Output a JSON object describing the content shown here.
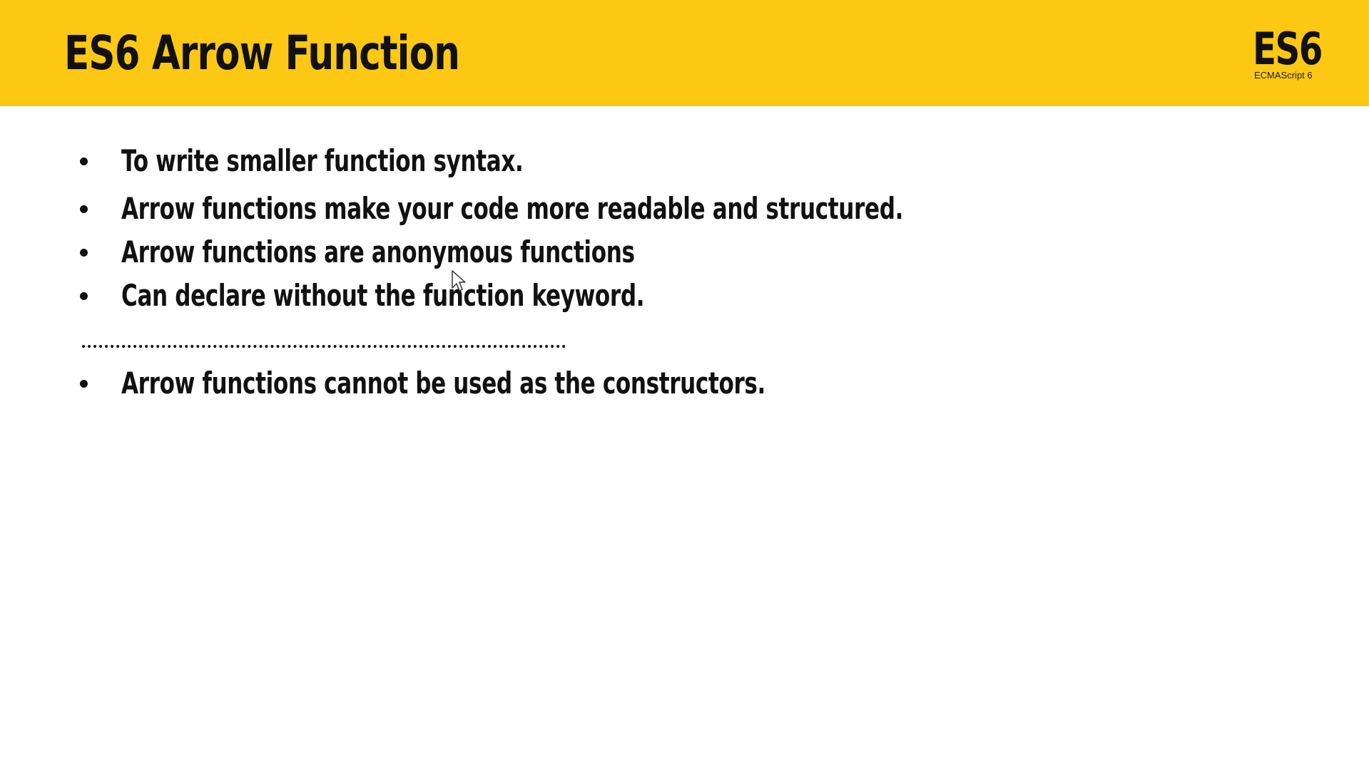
{
  "slide": {
    "title": "ES6 Arrow Function",
    "logo": {
      "main": "ES6",
      "sub": "ECMAScript 6"
    },
    "bullets": [
      "To write smaller function syntax.",
      "Arrow functions make your code more readable and structured.",
      "Arrow functions are anonymous functions",
      "Can declare without the function keyword."
    ],
    "bullets_after_separator": [
      "Arrow functions cannot be used as the constructors."
    ]
  },
  "colors": {
    "header_background": "#fcc814",
    "text": "#111111",
    "page_background": "#ffffff"
  },
  "icons": {
    "cursor": "mouse-pointer-icon",
    "bullet": "bullet-dot-icon"
  }
}
